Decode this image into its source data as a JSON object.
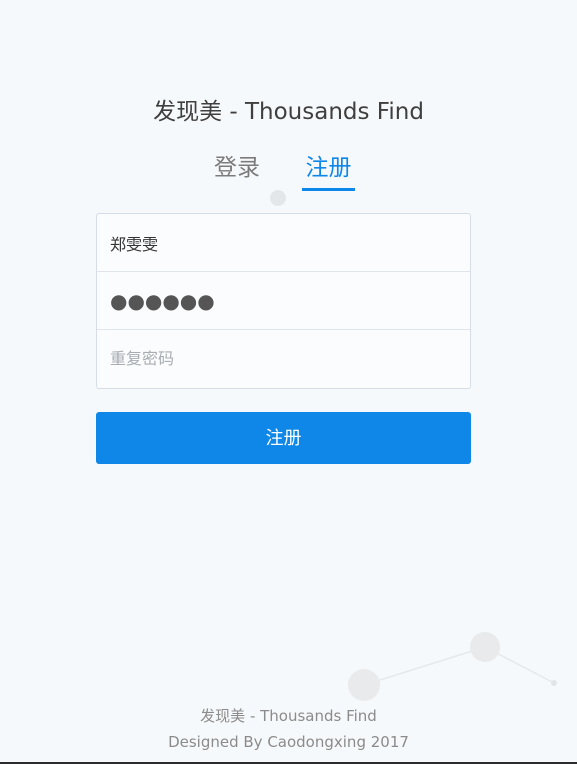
{
  "app": {
    "title": "发现美 - Thousands Find"
  },
  "tabs": [
    {
      "label": "登录",
      "active": false
    },
    {
      "label": "注册",
      "active": true
    }
  ],
  "form": {
    "username": {
      "value": "郑雯雯",
      "placeholder": ""
    },
    "password": {
      "value": "●●●●●●",
      "placeholder": ""
    },
    "confirm_password": {
      "value": "",
      "placeholder": "重复密码"
    }
  },
  "submit": {
    "label": "注册"
  },
  "footer": {
    "line1": "发现美 - Thousands Find",
    "line2": "Designed By Caodongxing 2017"
  },
  "colors": {
    "accent": "#0f87e8",
    "background": "#f6f9fb",
    "text_muted": "#8b8b8b"
  }
}
